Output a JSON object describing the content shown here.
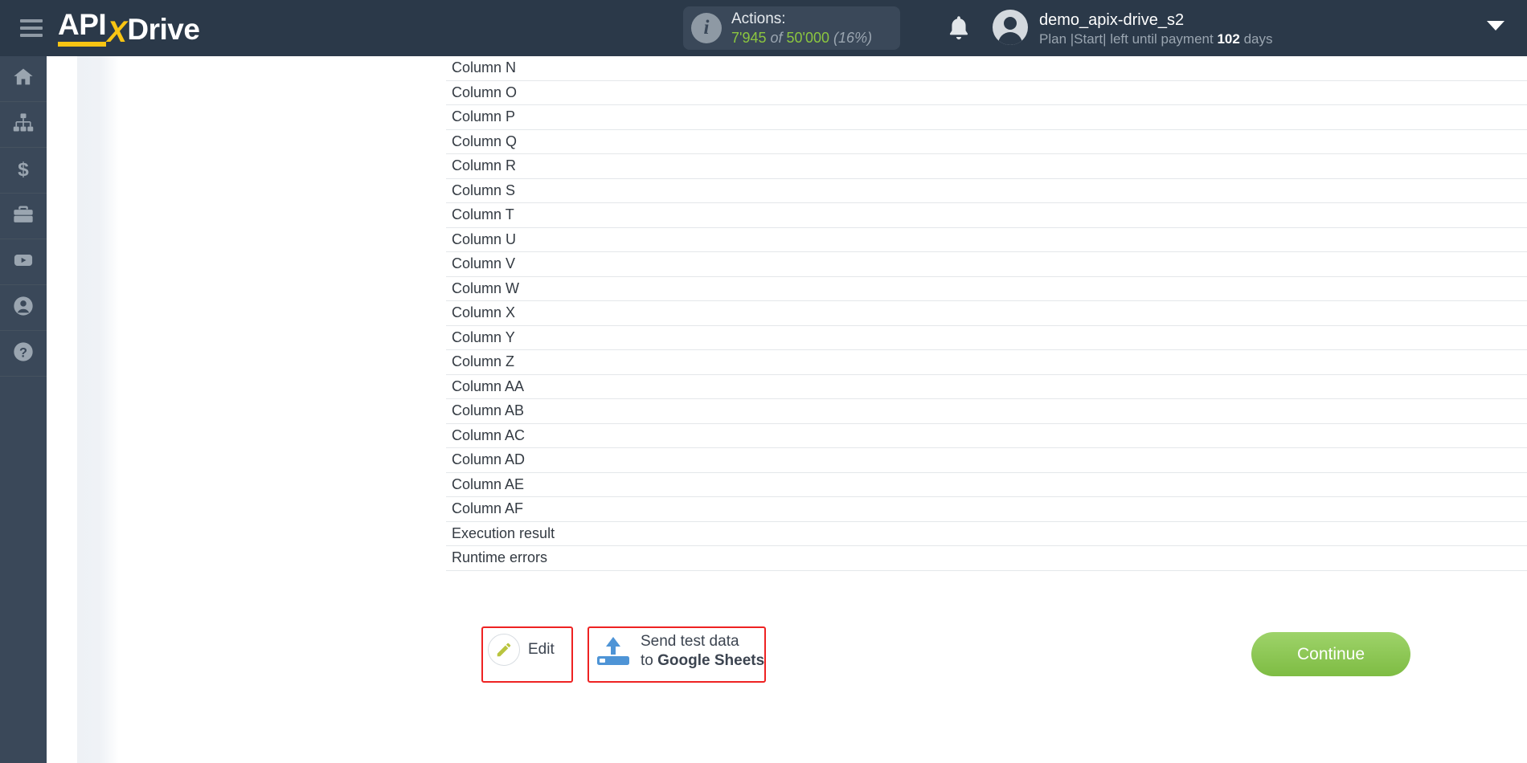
{
  "header": {
    "menu_icon": "hamburger-menu-icon",
    "logo": {
      "part1": "API",
      "part2": "X",
      "part3": "Drive"
    },
    "actions": {
      "info_icon": "info-icon",
      "title": "Actions:",
      "used": "7'945",
      "of": "of",
      "total": "50'000",
      "percent": "(16%)"
    },
    "notifications_icon": "bell-icon",
    "account": {
      "avatar_icon": "user-avatar-icon",
      "username": "demo_apix-drive_s2",
      "plan_prefix": "Plan |Start| left until payment",
      "plan_days": "102",
      "plan_suffix": "days"
    },
    "dropdown_icon": "chevron-down-icon"
  },
  "sidebar": {
    "items": [
      {
        "name": "sidebar-item-home",
        "icon": "home-icon"
      },
      {
        "name": "sidebar-item-connections",
        "icon": "sitemap-icon"
      },
      {
        "name": "sidebar-item-billing",
        "icon": "dollar-icon"
      },
      {
        "name": "sidebar-item-services",
        "icon": "briefcase-icon"
      },
      {
        "name": "sidebar-item-video",
        "icon": "youtube-icon"
      },
      {
        "name": "sidebar-item-account",
        "icon": "user-circle-icon"
      },
      {
        "name": "sidebar-item-help",
        "icon": "question-circle-icon"
      }
    ]
  },
  "main": {
    "fields": [
      "Column N",
      "Column O",
      "Column P",
      "Column Q",
      "Column R",
      "Column S",
      "Column T",
      "Column U",
      "Column V",
      "Column W",
      "Column X",
      "Column Y",
      "Column Z",
      "Column AA",
      "Column AB",
      "Column AC",
      "Column AD",
      "Column AE",
      "Column AF",
      "Execution result",
      "Runtime errors"
    ]
  },
  "footer": {
    "edit_button": {
      "label": "Edit",
      "icon": "pencil-icon",
      "highlight_color": "#ee2222"
    },
    "send_test_button": {
      "line1": "Send test data",
      "line2_prefix": "to ",
      "line2_bold": "Google Sheets",
      "icon": "upload-icon",
      "highlight_color": "#ee2222"
    },
    "continue_button": {
      "label": "Continue",
      "color": "#7ebc43"
    }
  }
}
